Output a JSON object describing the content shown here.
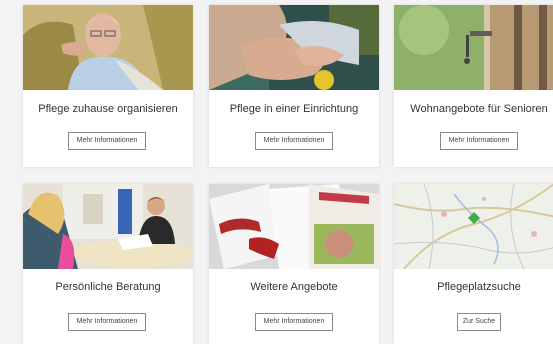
{
  "cards": [
    {
      "title": "Pflege zuhause organisieren",
      "button": "Mehr Informationen"
    },
    {
      "title": "Pflege in einer Einrichtung",
      "button": "Mehr Informationen"
    },
    {
      "title": "Wohnangebote für Senioren",
      "button": "Mehr Informationen"
    },
    {
      "title": "Persönliche Beratung",
      "button": "Mehr Informationen"
    },
    {
      "title": "Weitere Angebote",
      "button": "Mehr Informationen"
    },
    {
      "title": "Pflegeplatzsuche",
      "button": "Zur Suche"
    }
  ]
}
